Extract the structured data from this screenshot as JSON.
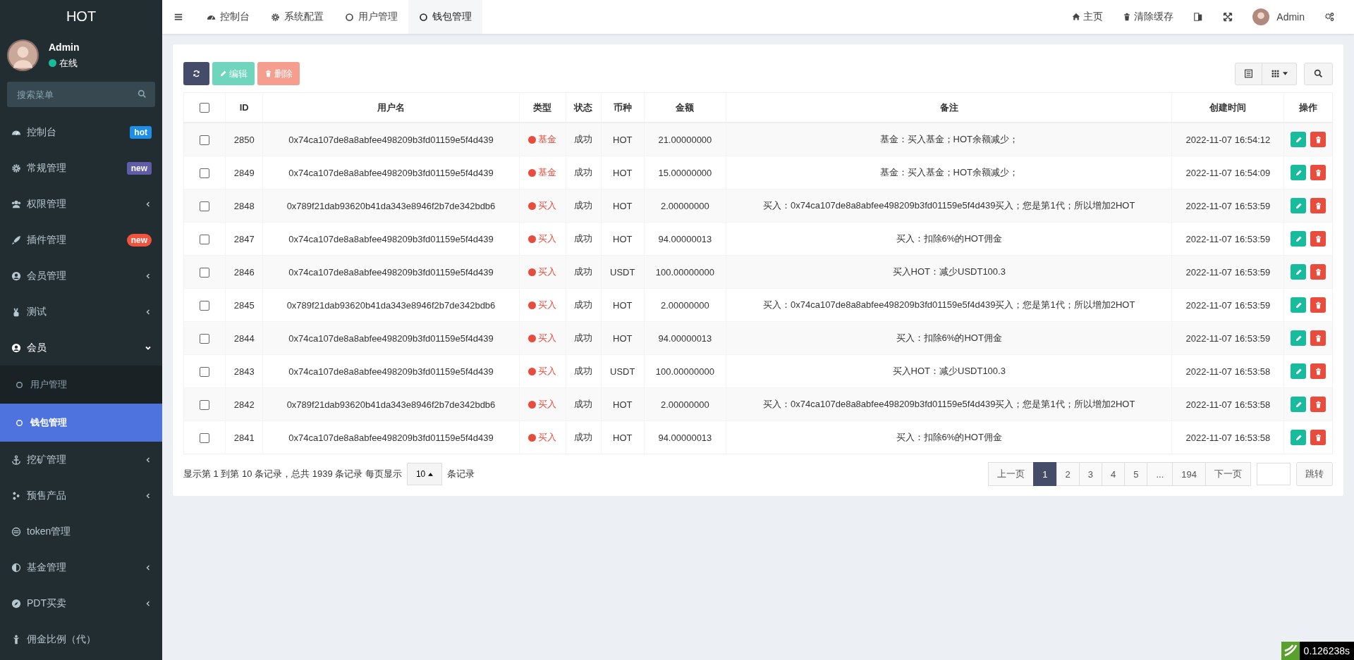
{
  "sidebar": {
    "logo": "HOT",
    "user": {
      "name": "Admin",
      "status": "在线",
      "online": true
    },
    "search": {
      "placeholder": "搜索菜单"
    },
    "items": [
      {
        "label": "控制台",
        "kind": "badge",
        "badge": "hot",
        "color": "#1e8fe8"
      },
      {
        "label": "常规管理",
        "kind": "badge",
        "badge": "new",
        "color": "#605ca8"
      },
      {
        "label": "权限管理",
        "kind": "arrow",
        "expanded": false
      },
      {
        "label": "插件管理",
        "kind": "badge",
        "badge": "new",
        "color": "#f0543f"
      },
      {
        "label": "会员管理",
        "kind": "arrow",
        "expanded": false
      },
      {
        "label": "测试",
        "kind": "arrow",
        "expanded": false
      },
      {
        "label": "会员",
        "kind": "arrow",
        "expanded": true,
        "children": [
          {
            "label": "用户管理",
            "selected": false
          },
          {
            "label": "钱包管理",
            "selected": true
          }
        ]
      },
      {
        "label": "挖矿管理",
        "kind": "arrow",
        "expanded": false
      },
      {
        "label": "预售产品",
        "kind": "arrow",
        "expanded": false
      },
      {
        "label": "token管理",
        "kind": "plain"
      },
      {
        "label": "基金管理",
        "kind": "arrow",
        "expanded": false
      },
      {
        "label": "PDT买卖",
        "kind": "arrow",
        "expanded": false
      },
      {
        "label": "佣金比例（代）",
        "kind": "plain"
      }
    ]
  },
  "tabs": [
    {
      "label": "控制台",
      "selected": false
    },
    {
      "label": "系统配置",
      "selected": false
    },
    {
      "label": "用户管理",
      "selected": false
    },
    {
      "label": "钱包管理",
      "selected": true
    }
  ],
  "topbar": {
    "home": "主页",
    "clear_cache": "清除缓存",
    "user": "Admin"
  },
  "toolbar": {
    "edit": "编辑",
    "delete": "删除"
  },
  "table": {
    "select_all_checked": false,
    "columns": [
      "ID",
      "用户名",
      "类型",
      "状态",
      "币种",
      "金额",
      "备注",
      "创建时间",
      "操作"
    ],
    "rows": [
      {
        "id": "2850",
        "user": "0x74ca107de8a8abfee498209b3fd01159e5f4d439",
        "type": "基金",
        "status": "成功",
        "currency": "HOT",
        "amount": "21.00000000",
        "note": "基金：买入基金；HOT余额减少；",
        "time": "2022-11-07 16:54:12",
        "checked": false
      },
      {
        "id": "2849",
        "user": "0x74ca107de8a8abfee498209b3fd01159e5f4d439",
        "type": "基金",
        "status": "成功",
        "currency": "HOT",
        "amount": "15.00000000",
        "note": "基金：买入基金；HOT余额减少；",
        "time": "2022-11-07 16:54:09",
        "checked": false
      },
      {
        "id": "2848",
        "user": "0x789f21dab93620b41da343e8946f2b7de342bdb6",
        "type": "买入",
        "status": "成功",
        "currency": "HOT",
        "amount": "2.00000000",
        "note": "买入：0x74ca107de8a8abfee498209b3fd01159e5f4d439买入；您是第1代；所以增加2HOT",
        "time": "2022-11-07 16:53:59",
        "checked": false
      },
      {
        "id": "2847",
        "user": "0x74ca107de8a8abfee498209b3fd01159e5f4d439",
        "type": "买入",
        "status": "成功",
        "currency": "HOT",
        "amount": "94.00000013",
        "note": "买入：扣除6%的HOT佣金",
        "time": "2022-11-07 16:53:59",
        "checked": false
      },
      {
        "id": "2846",
        "user": "0x74ca107de8a8abfee498209b3fd01159e5f4d439",
        "type": "买入",
        "status": "成功",
        "currency": "USDT",
        "amount": "100.00000000",
        "note": "买入HOT：减少USDT100.3",
        "time": "2022-11-07 16:53:59",
        "checked": false
      },
      {
        "id": "2845",
        "user": "0x789f21dab93620b41da343e8946f2b7de342bdb6",
        "type": "买入",
        "status": "成功",
        "currency": "HOT",
        "amount": "2.00000000",
        "note": "买入：0x74ca107de8a8abfee498209b3fd01159e5f4d439买入；您是第1代；所以增加2HOT",
        "time": "2022-11-07 16:53:59",
        "checked": false
      },
      {
        "id": "2844",
        "user": "0x74ca107de8a8abfee498209b3fd01159e5f4d439",
        "type": "买入",
        "status": "成功",
        "currency": "HOT",
        "amount": "94.00000013",
        "note": "买入：扣除6%的HOT佣金",
        "time": "2022-11-07 16:53:59",
        "checked": false
      },
      {
        "id": "2843",
        "user": "0x74ca107de8a8abfee498209b3fd01159e5f4d439",
        "type": "买入",
        "status": "成功",
        "currency": "USDT",
        "amount": "100.00000000",
        "note": "买入HOT：减少USDT100.3",
        "time": "2022-11-07 16:53:58",
        "checked": false
      },
      {
        "id": "2842",
        "user": "0x789f21dab93620b41da343e8946f2b7de342bdb6",
        "type": "买入",
        "status": "成功",
        "currency": "HOT",
        "amount": "2.00000000",
        "note": "买入：0x74ca107de8a8abfee498209b3fd01159e5f4d439买入；您是第1代；所以增加2HOT",
        "time": "2022-11-07 16:53:58",
        "checked": false
      },
      {
        "id": "2841",
        "user": "0x74ca107de8a8abfee498209b3fd01159e5f4d439",
        "type": "买入",
        "status": "成功",
        "currency": "HOT",
        "amount": "94.00000013",
        "note": "买入：扣除6%的HOT佣金",
        "time": "2022-11-07 16:53:58",
        "checked": false
      }
    ]
  },
  "footer": {
    "summary": "显示第 1 到第 10 条记录，总共 1939 条记录 每页显示",
    "page_size": "10",
    "summary_end": "条记录"
  },
  "pagination": {
    "prev": "上一页",
    "next": "下一页",
    "pages": [
      {
        "label": "1",
        "selected": true
      },
      {
        "label": "2",
        "selected": false
      },
      {
        "label": "3",
        "selected": false
      },
      {
        "label": "4",
        "selected": false
      },
      {
        "label": "5",
        "selected": false
      },
      {
        "label": "...",
        "selected": false
      },
      {
        "label": "194",
        "selected": false
      }
    ],
    "jump": "跳转"
  },
  "debug": {
    "time": "0.126238s"
  }
}
